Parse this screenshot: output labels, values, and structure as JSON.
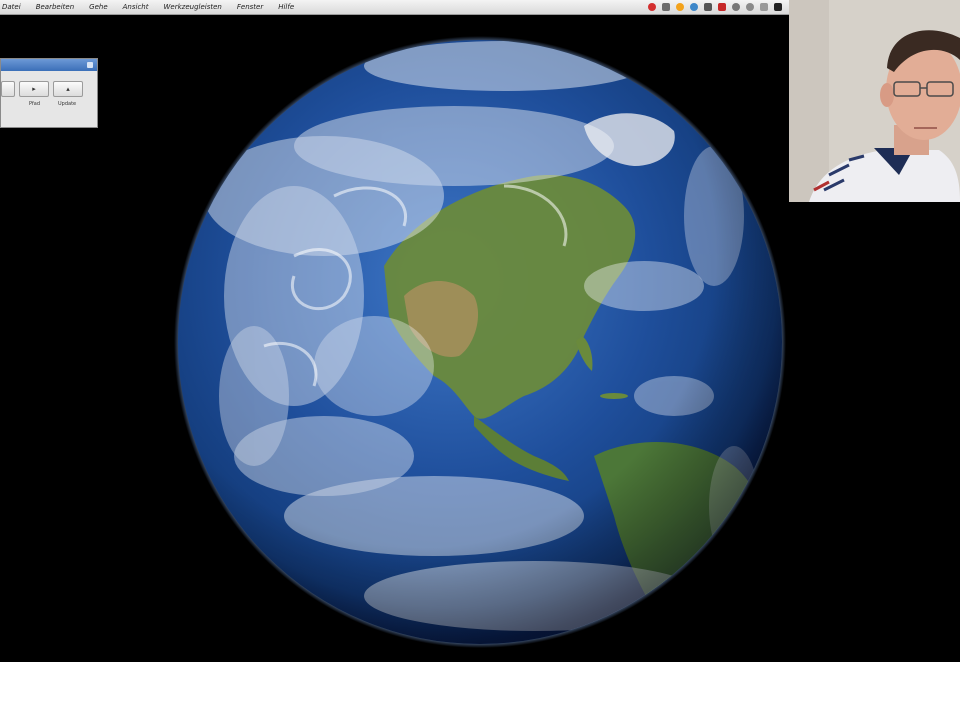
{
  "menubar": {
    "items": [
      "Datei",
      "Bearbeiten",
      "Gehe",
      "Ansicht",
      "Werkzeugleisten",
      "Fenster",
      "Hilfe"
    ]
  },
  "mini_window": {
    "labels": [
      "Pfad",
      "Update"
    ]
  },
  "colors": {
    "ocean": "#1f4f9c",
    "land": "#6a8a3c",
    "background": "#000000",
    "menubar": "#e6e6e6"
  }
}
